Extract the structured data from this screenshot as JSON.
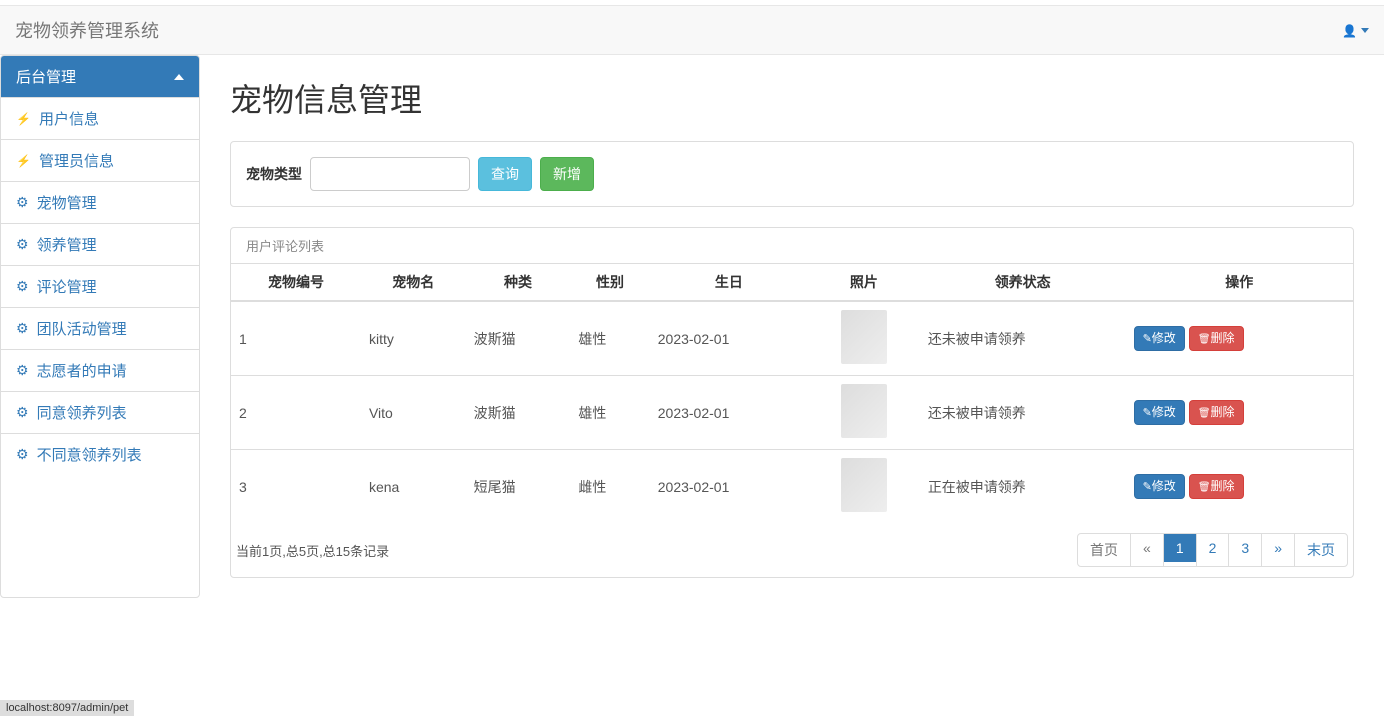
{
  "navbar": {
    "brand": "宠物领养管理系统"
  },
  "sidebar": {
    "header": "后台管理",
    "items": [
      {
        "label": "用户信息",
        "icon": "bolt"
      },
      {
        "label": "管理员信息",
        "icon": "bolt"
      },
      {
        "label": "宠物管理",
        "icon": "sitemap"
      },
      {
        "label": "领养管理",
        "icon": "sitemap"
      },
      {
        "label": "评论管理",
        "icon": "sitemap"
      },
      {
        "label": "团队活动管理",
        "icon": "sitemap"
      },
      {
        "label": "志愿者的申请",
        "icon": "sitemap"
      },
      {
        "label": "同意领养列表",
        "icon": "sitemap"
      },
      {
        "label": "不同意领养列表",
        "icon": "sitemap"
      }
    ]
  },
  "page": {
    "title": "宠物信息管理",
    "filter_label": "宠物类型",
    "filter_value": "",
    "search_btn": "查询",
    "add_btn": "新增"
  },
  "table": {
    "panel_title": "用户评论列表",
    "headers": [
      "宠物编号",
      "宠物名",
      "种类",
      "性别",
      "生日",
      "照片",
      "领养状态",
      "操作"
    ],
    "rows": [
      {
        "id": "1",
        "name": "kitty",
        "breed": "波斯猫",
        "gender": "雄性",
        "birthday": "2023-02-01",
        "status": "还未被申请领养"
      },
      {
        "id": "2",
        "name": "Vito",
        "breed": "波斯猫",
        "gender": "雄性",
        "birthday": "2023-02-01",
        "status": "还未被申请领养"
      },
      {
        "id": "3",
        "name": "kena",
        "breed": "短尾猫",
        "gender": "雌性",
        "birthday": "2023-02-01",
        "status": "正在被申请领养"
      }
    ],
    "edit_btn": "修改",
    "delete_btn": "删除"
  },
  "pagination": {
    "info": "当前1页,总5页,总15条记录",
    "first": "首页",
    "prev": "«",
    "pages": [
      "1",
      "2",
      "3"
    ],
    "active": "1",
    "next": "»",
    "last": "末页"
  },
  "status_bar": "localhost:8097/admin/pet"
}
